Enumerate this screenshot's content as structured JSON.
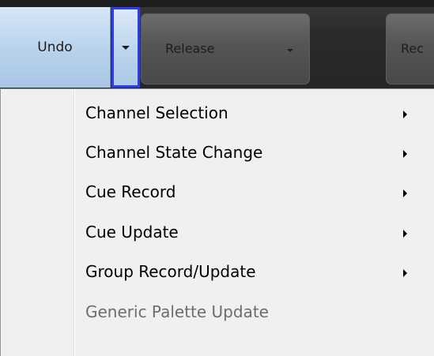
{
  "toolbar": {
    "undo_label": "Undo",
    "release_label": "Release",
    "record_label": "Rec"
  },
  "menu": {
    "items": [
      {
        "label": "Channel Selection",
        "has_submenu": true
      },
      {
        "label": "Channel State Change",
        "has_submenu": true
      },
      {
        "label": "Cue Record",
        "has_submenu": true
      },
      {
        "label": "Cue Update",
        "has_submenu": true
      },
      {
        "label": "Group Record/Update",
        "has_submenu": true
      },
      {
        "label": "Generic Palette Update",
        "has_submenu": false,
        "disabled": true
      }
    ]
  },
  "colors": {
    "undo_highlight": "#b8d2ec",
    "focus_border": "#2d3cf0",
    "toolbar_bg": "#2a2a2a",
    "menu_bg": "#f0f0f0",
    "disabled_text": "#6d6d6d"
  }
}
